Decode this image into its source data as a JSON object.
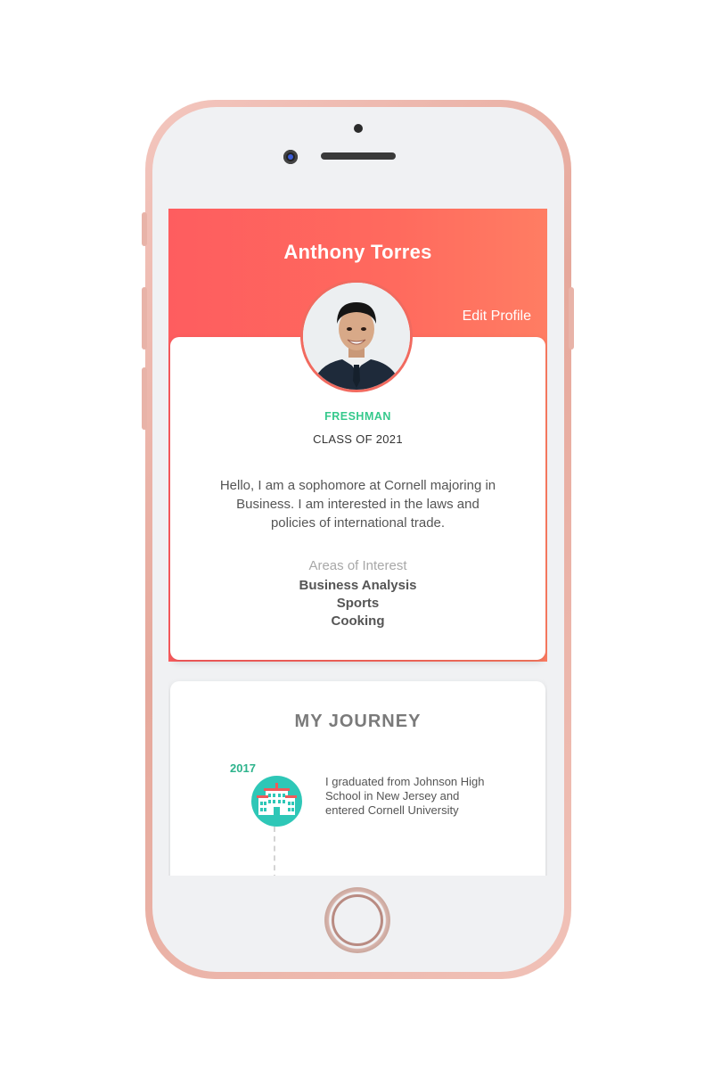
{
  "profile": {
    "name": "Anthony Torres",
    "edit_label": "Edit Profile",
    "year_level": "FRESHMAN",
    "class_of": "CLASS OF 2021",
    "bio": "Hello, I am a sophomore at Cornell majoring in Business. I am interested in the laws and policies of international trade.",
    "interests_heading": "Areas of Interest",
    "interests": [
      "Business Analysis",
      "Sports",
      "Cooking"
    ]
  },
  "journey": {
    "title": "MY JOURNEY",
    "items": [
      {
        "year": "2017",
        "icon": "school-building-icon",
        "text": "I graduated from Johnson High School in New Jersey and entered Cornell University"
      }
    ]
  },
  "colors": {
    "header_gradient_start": "#fe5d5f",
    "header_gradient_end": "#ff7d63",
    "year_level": "#35c98c",
    "timeline_year": "#2db38c",
    "timeline_icon": "#2ec7b7",
    "phone_frame": "#f1c2b8"
  }
}
